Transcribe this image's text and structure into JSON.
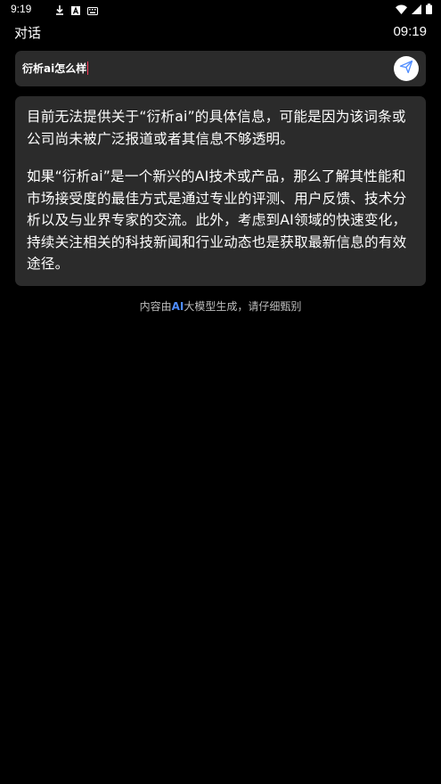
{
  "status_bar": {
    "time": "9:19",
    "left_icons": [
      "download-icon",
      "a-box-icon",
      "keyboard-icon"
    ],
    "right_icons": [
      "wifi-icon",
      "cell-signal-icon",
      "battery-icon"
    ]
  },
  "header": {
    "title": "对话",
    "time": "09:19"
  },
  "input": {
    "value": "衍析ai怎么样",
    "caret_color": "#ff3b5c"
  },
  "send_button": {
    "icon": "send-icon",
    "icon_color": "#4e8cff"
  },
  "answer": {
    "paragraphs": [
      "目前无法提供关于“衍析ai”的具体信息，可能是因为该词条或公司尚未被广泛报道或者其信息不够透明。",
      "如果“衍析ai”是一个新兴的AI技术或产品，那么了解其性能和市场接受度的最佳方式是通过专业的评测、用户反馈、技术分析以及与业界专家的交流。此外，考虑到AI领域的快速变化，持续关注相关的科技新闻和行业动态也是获取最新信息的有效途径。"
    ]
  },
  "disclaimer": {
    "prefix": "内容由",
    "highlight": "AI",
    "suffix": "大模型生成，请仔细甄别",
    "highlight_color": "#4e8cff"
  }
}
